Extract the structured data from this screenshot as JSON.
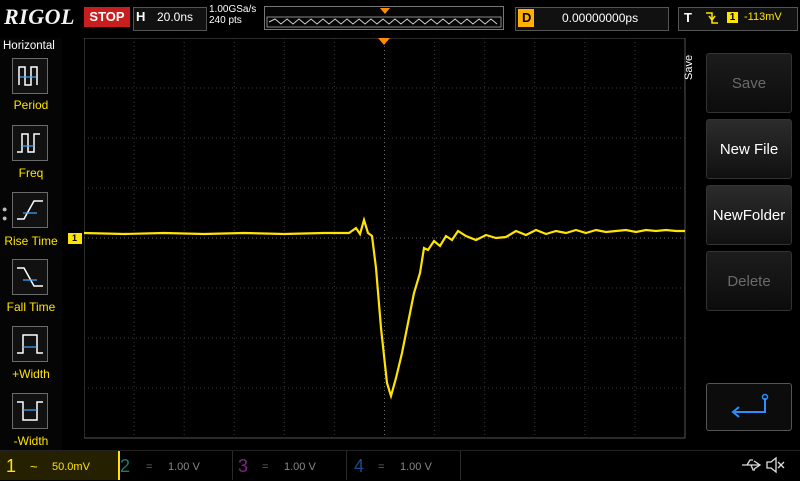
{
  "top": {
    "brand": "RIGOL",
    "run_state": "STOP",
    "horizontal_label": "H",
    "timebase": "20.0ns",
    "sample_rate": "1.00GSa/s",
    "memory_depth": "240  pts",
    "delay_label": "D",
    "delay_value": "0.00000000ps",
    "trigger_label": "T",
    "trigger_channel": "1",
    "trigger_level": "-113mV"
  },
  "left_menu": {
    "title": "Horizontal",
    "items": [
      {
        "label": "Period",
        "icon": "period-icon"
      },
      {
        "label": "Freq",
        "icon": "freq-icon"
      },
      {
        "label": "Rise Time",
        "icon": "rise-time-icon"
      },
      {
        "label": "Fall Time",
        "icon": "fall-time-icon"
      },
      {
        "label": "+Width",
        "icon": "positive-width-icon"
      },
      {
        "label": "-Width",
        "icon": "negative-width-icon"
      }
    ]
  },
  "right_menu": {
    "title": "Save",
    "buttons": [
      {
        "label": "Save",
        "state": "disabled"
      },
      {
        "label": "New File",
        "state": "enabled"
      },
      {
        "label": "NewFolder",
        "state": "enabled"
      },
      {
        "label": "Delete",
        "state": "disabled"
      },
      {
        "label": "",
        "icon": "return-arrow-icon",
        "state": "active"
      }
    ]
  },
  "markers": {
    "channel1": "1",
    "trigger": "T"
  },
  "channels": [
    {
      "number": "1",
      "coupling": "~",
      "scale": "50.0mV",
      "color": "#ffe400",
      "enabled": true
    },
    {
      "number": "2",
      "coupling": "=",
      "scale": "1.00 V",
      "color": "#00c8c8",
      "enabled": false
    },
    {
      "number": "3",
      "coupling": "=",
      "scale": "1.00 V",
      "color": "#e040e0",
      "enabled": false
    },
    {
      "number": "4",
      "coupling": "=",
      "scale": "1.00 V",
      "color": "#2a7fff",
      "enabled": false
    }
  ],
  "status": {
    "usb_icon": "usb-icon",
    "sound_icon": "speaker-muted-icon"
  },
  "colors": {
    "trace": "#ffe400",
    "trigger_marker": "#ff8c00",
    "grid": "#3a3a3a",
    "stop": "#c81e1e"
  }
}
